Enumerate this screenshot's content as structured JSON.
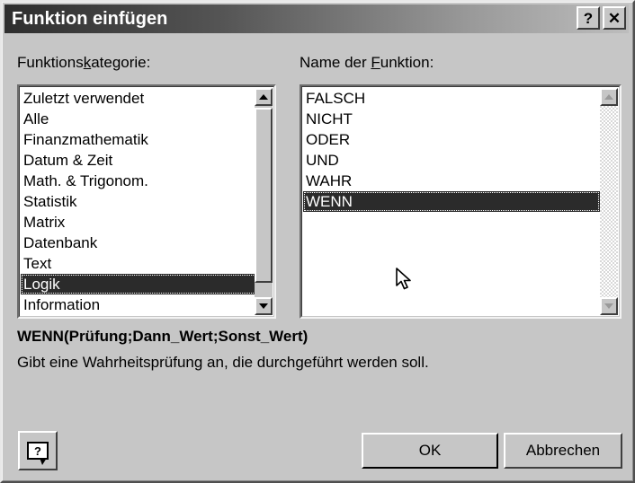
{
  "window": {
    "title": "Funktion einfügen",
    "title_buttons": [
      {
        "name": "help",
        "glyph": "?"
      },
      {
        "name": "close",
        "glyph": "✕"
      }
    ]
  },
  "labels": {
    "category_before": "Funktions",
    "category_accel": "k",
    "category_after": "ategorie:",
    "function_before": "Name der ",
    "function_accel": "F",
    "function_after": "unktion:"
  },
  "category_list": {
    "items": [
      "Zuletzt verwendet",
      "Alle",
      "Finanzmathematik",
      "Datum & Zeit",
      "Math. & Trigonom.",
      "Statistik",
      "Matrix",
      "Datenbank",
      "Text",
      "Logik",
      "Information"
    ],
    "selected_index": 9,
    "scrollbar": {
      "up_glyph": "▲",
      "down_glyph": "▼",
      "enabled": true
    }
  },
  "function_list": {
    "items": [
      "FALSCH",
      "NICHT",
      "ODER",
      "UND",
      "WAHR",
      "WENN"
    ],
    "selected_index": 5,
    "scrollbar": {
      "up_glyph": "▲",
      "down_glyph": "▼",
      "enabled": false
    }
  },
  "description": {
    "signature": "WENN(Prüfung;Dann_Wert;Sonst_Wert)",
    "text": "Gibt eine Wahrheitsprüfung an, die durchgeführt werden soll."
  },
  "buttons": {
    "help_label": "?",
    "ok_label": "OK",
    "cancel_label": "Abbrechen"
  },
  "colors": {
    "face": "#c6c6c6",
    "selection": "#2b2b2b",
    "title_start": "#2e2e2e",
    "title_end": "#bdbdbd"
  }
}
